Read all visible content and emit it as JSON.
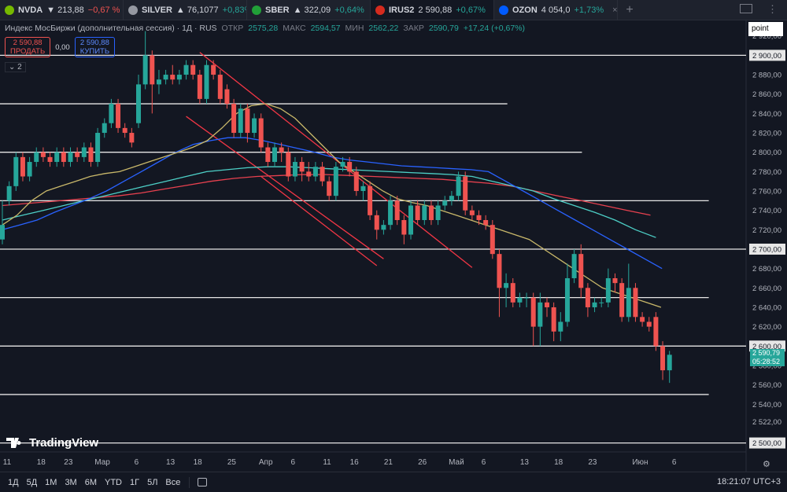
{
  "tabs": [
    {
      "symbol": "NVDA",
      "arrow": "▼",
      "price": "213,88",
      "change": "−0,67 %",
      "dir": "down",
      "icon_color": "#76b900",
      "active": false
    },
    {
      "symbol": "SILVER",
      "arrow": "▲",
      "price": "76,1077",
      "change": "+0,83%",
      "dir": "up",
      "icon_color": "#9598a1",
      "active": false
    },
    {
      "symbol": "SBER",
      "arrow": "▲",
      "price": "322,09",
      "change": "+0,64%",
      "dir": "up",
      "icon_color": "#21a038",
      "active": false
    },
    {
      "symbol": "IRUS2",
      "arrow": "",
      "price": "2 590,88",
      "change": "+0,67%",
      "dir": "up",
      "icon_color": "#d52b1e",
      "active": true
    },
    {
      "symbol": "OZON",
      "arrow": "",
      "price": "4 054,0",
      "change": "+1,73%",
      "dir": "up",
      "icon_color": "#005bff",
      "active": false
    }
  ],
  "plus_label": "+",
  "legend": {
    "title": "Индекс МосБиржи (дополнительная сессия) · 1Д · RUS",
    "open_label": "ОТКР",
    "open": "2575,28",
    "high_label": "МАКС",
    "high": "2594,57",
    "low_label": "МИН",
    "low": "2562,22",
    "close_label": "ЗАКР",
    "close": "2590,79",
    "change": "+17,24 (+0,67%)"
  },
  "trade": {
    "sell_price": "2 590,88",
    "sell_label": "ПРОДАТЬ",
    "spread": "0,00",
    "buy_price": "2 590,88",
    "buy_label": "КУПИТЬ"
  },
  "indicator_count": "2",
  "drawing_tool": "point",
  "current_price": "2 590,79",
  "countdown": "05:28:52",
  "logo_text": "TradingView",
  "ranges": [
    "1Д",
    "5Д",
    "1М",
    "3М",
    "6М",
    "YTD",
    "1Г",
    "5Л",
    "Все"
  ],
  "clock": "18:21:07 UTC+3",
  "colors": {
    "up": "#26a69a",
    "down": "#ef5350",
    "ma_yellow": "#c9b86a",
    "ma_blue": "#2962ff",
    "ma_cyan": "#4dd0c7",
    "ma_red": "#e8414f",
    "channel": "#f23645"
  },
  "chart_data": {
    "type": "candlestick",
    "y_ticks": [
      2500,
      2522,
      2540,
      2560,
      2580,
      2600,
      2620,
      2640,
      2660,
      2680,
      2700,
      2720,
      2740,
      2760,
      2780,
      2800,
      2820,
      2840,
      2860,
      2880,
      2900,
      2920
    ],
    "y_tick_labels": [
      "2 500,00",
      "2 522,00",
      "2 540,00",
      "2 560,00",
      "2 580,00",
      "2 600,00",
      "2 620,00",
      "2 640,00",
      "2 660,00",
      "2 680,00",
      "2 700,00",
      "2 720,00",
      "2 740,00",
      "2 760,00",
      "2 780,00",
      "2 800,00",
      "2 820,00",
      "2 840,00",
      "2 860,00",
      "2 880,00",
      "2 900,00",
      "2 920,00"
    ],
    "highlighted_y_labels": [
      "2 500,00",
      "2 600,00",
      "2 700,00",
      "2 900,00"
    ],
    "ylim": [
      2494,
      2936
    ],
    "x_tick_labels": [
      "11",
      "18",
      "23",
      "Мар",
      "6",
      "13",
      "18",
      "25",
      "Апр",
      "6",
      "11",
      "16",
      "21",
      "26",
      "Май",
      "6",
      "13",
      "18",
      "23",
      "Июн",
      "6"
    ],
    "x_tick_bar_index": [
      0,
      5,
      9,
      14,
      19,
      24,
      28,
      33,
      38,
      42,
      47,
      51,
      56,
      61,
      66,
      70,
      76,
      81,
      86,
      93,
      98
    ],
    "horizontal_levels": [
      {
        "value": 2937,
        "x_end_frac": 0.95
      },
      {
        "value": 2900,
        "x_end_frac": 1.0
      },
      {
        "value": 2850,
        "x_end_frac": 0.68
      },
      {
        "value": 2800,
        "x_end_frac": 0.78
      },
      {
        "value": 2750,
        "x_end_frac": 0.95
      },
      {
        "value": 2700,
        "x_end_frac": 1.0
      },
      {
        "value": 2650,
        "x_end_frac": 0.95
      },
      {
        "value": 2600,
        "x_end_frac": 1.0
      },
      {
        "value": 2550,
        "x_end_frac": 0.95
      },
      {
        "value": 2500,
        "x_end_frac": 1.0
      }
    ],
    "channel_lines": [
      {
        "x1": 29,
        "y1": 2903,
        "x2": 69,
        "y2": 2681
      },
      {
        "x1": 27,
        "y1": 2837,
        "x2": 56,
        "y2": 2690
      },
      {
        "x1": 38,
        "y1": 2775,
        "x2": 55,
        "y2": 2683
      }
    ],
    "candles": [
      [
        2710,
        2725,
        2705,
        2750
      ],
      [
        2750,
        2765,
        2745,
        2770
      ],
      [
        2765,
        2795,
        2760,
        2800
      ],
      [
        2795,
        2775,
        2770,
        2800
      ],
      [
        2775,
        2790,
        2770,
        2795
      ],
      [
        2790,
        2800,
        2785,
        2805
      ],
      [
        2800,
        2795,
        2790,
        2805
      ],
      [
        2795,
        2790,
        2785,
        2800
      ],
      [
        2790,
        2800,
        2785,
        2805
      ],
      [
        2800,
        2790,
        2785,
        2805
      ],
      [
        2790,
        2800,
        2785,
        2805
      ],
      [
        2800,
        2795,
        2790,
        2805
      ],
      [
        2795,
        2805,
        2790,
        2810
      ],
      [
        2805,
        2790,
        2785,
        2810
      ],
      [
        2790,
        2820,
        2785,
        2825
      ],
      [
        2820,
        2830,
        2815,
        2835
      ],
      [
        2830,
        2850,
        2825,
        2855
      ],
      [
        2850,
        2825,
        2820,
        2855
      ],
      [
        2825,
        2820,
        2815,
        2830
      ],
      [
        2820,
        2810,
        2805,
        2825
      ],
      [
        2830,
        2870,
        2825,
        2880
      ],
      [
        2870,
        2900,
        2865,
        2925
      ],
      [
        2900,
        2870,
        2840,
        2905
      ],
      [
        2870,
        2875,
        2860,
        2885
      ],
      [
        2875,
        2880,
        2870,
        2885
      ],
      [
        2880,
        2875,
        2870,
        2890
      ],
      [
        2875,
        2880,
        2870,
        2885
      ],
      [
        2880,
        2890,
        2875,
        2895
      ],
      [
        2890,
        2880,
        2875,
        2895
      ],
      [
        2880,
        2855,
        2850,
        2885
      ],
      [
        2855,
        2890,
        2850,
        2895
      ],
      [
        2890,
        2880,
        2875,
        2895
      ],
      [
        2880,
        2855,
        2850,
        2885
      ],
      [
        2865,
        2850,
        2845,
        2870
      ],
      [
        2850,
        2820,
        2815,
        2855
      ],
      [
        2820,
        2845,
        2815,
        2850
      ],
      [
        2845,
        2820,
        2810,
        2850
      ],
      [
        2820,
        2835,
        2815,
        2840
      ],
      [
        2835,
        2805,
        2800,
        2840
      ],
      [
        2805,
        2790,
        2785,
        2810
      ],
      [
        2790,
        2805,
        2785,
        2810
      ],
      [
        2805,
        2800,
        2790,
        2810
      ],
      [
        2800,
        2775,
        2770,
        2805
      ],
      [
        2775,
        2790,
        2770,
        2795
      ],
      [
        2790,
        2780,
        2770,
        2795
      ],
      [
        2780,
        2775,
        2770,
        2790
      ],
      [
        2775,
        2785,
        2770,
        2790
      ],
      [
        2785,
        2770,
        2765,
        2790
      ],
      [
        2770,
        2755,
        2750,
        2775
      ],
      [
        2755,
        2785,
        2750,
        2790
      ],
      [
        2785,
        2790,
        2780,
        2795
      ],
      [
        2790,
        2780,
        2775,
        2795
      ],
      [
        2780,
        2760,
        2755,
        2785
      ],
      [
        2760,
        2765,
        2750,
        2770
      ],
      [
        2765,
        2735,
        2730,
        2770
      ],
      [
        2735,
        2720,
        2710,
        2740
      ],
      [
        2720,
        2725,
        2715,
        2730
      ],
      [
        2725,
        2750,
        2720,
        2755
      ],
      [
        2750,
        2730,
        2725,
        2755
      ],
      [
        2730,
        2715,
        2705,
        2735
      ],
      [
        2715,
        2745,
        2710,
        2750
      ],
      [
        2745,
        2730,
        2725,
        2750
      ],
      [
        2730,
        2745,
        2725,
        2750
      ],
      [
        2745,
        2730,
        2725,
        2750
      ],
      [
        2730,
        2745,
        2725,
        2750
      ],
      [
        2745,
        2750,
        2740,
        2755
      ],
      [
        2750,
        2755,
        2745,
        2760
      ],
      [
        2755,
        2775,
        2750,
        2780
      ],
      [
        2775,
        2740,
        2735,
        2780
      ],
      [
        2740,
        2735,
        2730,
        2745
      ],
      [
        2735,
        2730,
        2725,
        2740
      ],
      [
        2730,
        2725,
        2720,
        2735
      ],
      [
        2725,
        2695,
        2690,
        2730
      ],
      [
        2695,
        2660,
        2630,
        2700
      ],
      [
        2660,
        2665,
        2640,
        2675
      ],
      [
        2665,
        2645,
        2640,
        2670
      ],
      [
        2645,
        2650,
        2640,
        2655
      ],
      [
        2650,
        2650,
        2640,
        2655
      ],
      [
        2650,
        2620,
        2600,
        2655
      ],
      [
        2620,
        2645,
        2600,
        2655
      ],
      [
        2645,
        2640,
        2630,
        2650
      ],
      [
        2640,
        2615,
        2605,
        2645
      ],
      [
        2615,
        2625,
        2605,
        2635
      ],
      [
        2625,
        2670,
        2620,
        2685
      ],
      [
        2670,
        2695,
        2665,
        2700
      ],
      [
        2695,
        2660,
        2650,
        2705
      ],
      [
        2660,
        2640,
        2630,
        2665
      ],
      [
        2640,
        2645,
        2635,
        2650
      ],
      [
        2645,
        2645,
        2640,
        2650
      ],
      [
        2645,
        2670,
        2640,
        2680
      ],
      [
        2670,
        2665,
        2655,
        2675
      ],
      [
        2665,
        2630,
        2625,
        2670
      ],
      [
        2630,
        2660,
        2625,
        2685
      ],
      [
        2660,
        2630,
        2625,
        2665
      ],
      [
        2630,
        2625,
        2620,
        2635
      ],
      [
        2625,
        2620,
        2615,
        2630
      ],
      [
        2630,
        2600,
        2595,
        2635
      ],
      [
        2600,
        2575,
        2565,
        2605
      ],
      [
        2575,
        2591,
        2562,
        2595
      ]
    ],
    "ma_yellow": [
      2725,
      2735,
      2750,
      2760,
      2765,
      2770,
      2775,
      2778,
      2780,
      2785,
      2790,
      2795,
      2800,
      2805,
      2812,
      2825,
      2840,
      2848,
      2850,
      2845,
      2835,
      2820,
      2805,
      2790,
      2780,
      2770,
      2760,
      2752,
      2748,
      2745,
      2740,
      2735,
      2730,
      2725,
      2720,
      2715,
      2710,
      2700,
      2690,
      2680,
      2670,
      2660,
      2655,
      2650,
      2645,
      2640
    ],
    "ma_blue": [
      2720,
      2725,
      2730,
      2738,
      2745,
      2752,
      2760,
      2770,
      2780,
      2790,
      2800,
      2808,
      2812,
      2815,
      2815,
      2812,
      2808,
      2804,
      2800,
      2795,
      2792,
      2790,
      2788,
      2786,
      2785,
      2784,
      2783,
      2782,
      2780,
      2770,
      2760,
      2750,
      2740,
      2730,
      2720,
      2710,
      2700,
      2690,
      2680
    ],
    "ma_cyan": [
      2730,
      2735,
      2740,
      2745,
      2750,
      2755,
      2760,
      2765,
      2770,
      2775,
      2780,
      2782,
      2784,
      2785,
      2785,
      2784,
      2783,
      2782,
      2781,
      2780,
      2779,
      2778,
      2777,
      2775,
      2770,
      2765,
      2760,
      2752,
      2745,
      2738,
      2730,
      2720,
      2712
    ],
    "ma_red": [
      2745,
      2747,
      2749,
      2751,
      2753,
      2755,
      2758,
      2762,
      2766,
      2770,
      2773,
      2775,
      2776,
      2777,
      2777,
      2776,
      2775,
      2774,
      2773,
      2772,
      2770,
      2768,
      2765,
      2760,
      2755,
      2750,
      2745,
      2740,
      2735
    ]
  }
}
